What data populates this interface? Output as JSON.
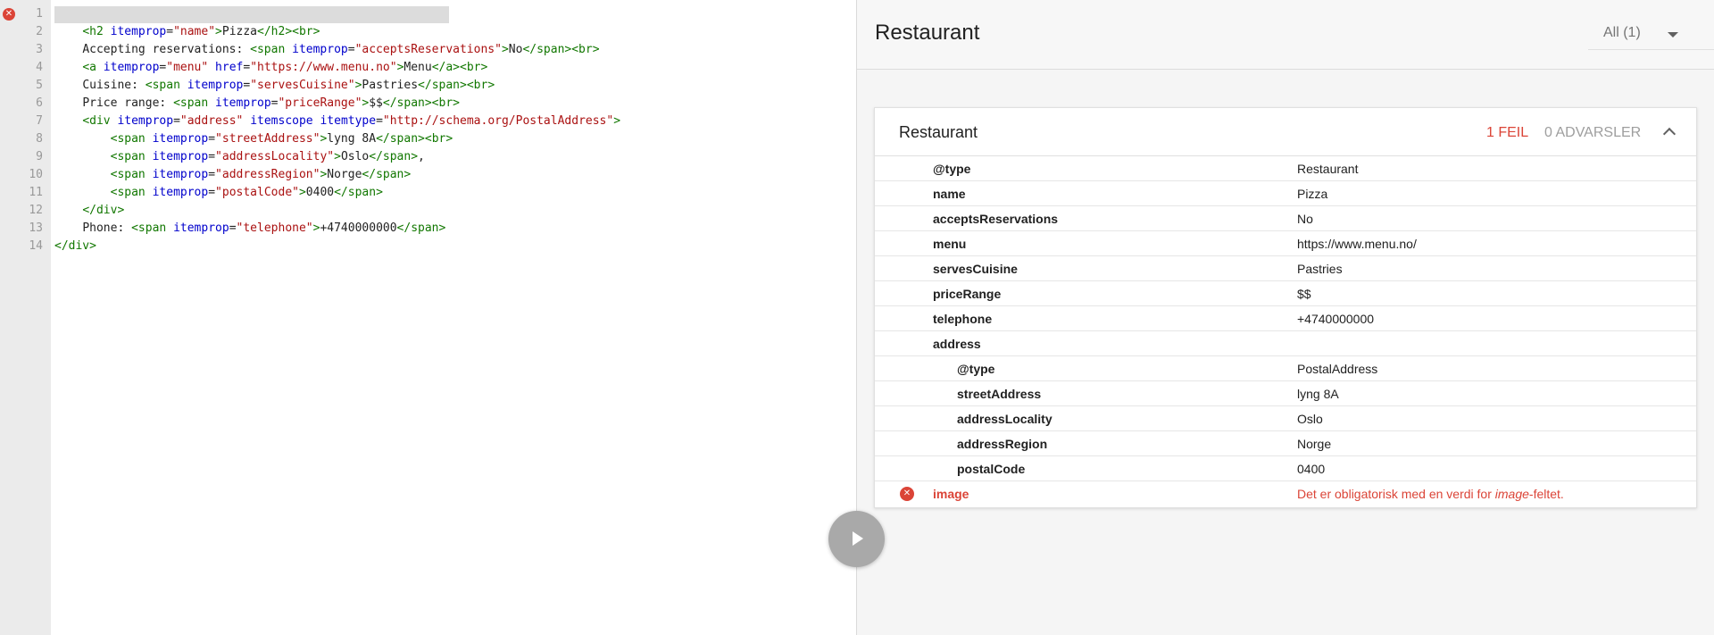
{
  "editor": {
    "line_numbers": [
      "1",
      "2",
      "3",
      "4",
      "5",
      "6",
      "7",
      "8",
      "9",
      "10",
      "11",
      "12",
      "13",
      "14"
    ],
    "error_marker": "✕",
    "lines": [
      [],
      [
        {
          "c": "t",
          "s": "<h2 "
        },
        {
          "c": "a",
          "s": "itemprop"
        },
        {
          "c": "",
          "s": "="
        },
        {
          "c": "v",
          "s": "\"name\""
        },
        {
          "c": "t",
          "s": ">"
        },
        {
          "c": "",
          "s": "Pizza"
        },
        {
          "c": "t",
          "s": "</h2><br>"
        }
      ],
      [
        {
          "c": "",
          "s": "Accepting reservations: "
        },
        {
          "c": "t",
          "s": "<span "
        },
        {
          "c": "a",
          "s": "itemprop"
        },
        {
          "c": "",
          "s": "="
        },
        {
          "c": "v",
          "s": "\"acceptsReservations\""
        },
        {
          "c": "t",
          "s": ">"
        },
        {
          "c": "",
          "s": "No"
        },
        {
          "c": "t",
          "s": "</span><br>"
        }
      ],
      [
        {
          "c": "t",
          "s": "<a "
        },
        {
          "c": "a",
          "s": "itemprop"
        },
        {
          "c": "",
          "s": "="
        },
        {
          "c": "v",
          "s": "\"menu\""
        },
        {
          "c": "",
          "s": " "
        },
        {
          "c": "a",
          "s": "href"
        },
        {
          "c": "",
          "s": "="
        },
        {
          "c": "v",
          "s": "\"https://www.menu.no\""
        },
        {
          "c": "t",
          "s": ">"
        },
        {
          "c": "",
          "s": "Menu"
        },
        {
          "c": "t",
          "s": "</a><br>"
        }
      ],
      [
        {
          "c": "",
          "s": "Cuisine: "
        },
        {
          "c": "t",
          "s": "<span "
        },
        {
          "c": "a",
          "s": "itemprop"
        },
        {
          "c": "",
          "s": "="
        },
        {
          "c": "v",
          "s": "\"servesCuisine\""
        },
        {
          "c": "t",
          "s": ">"
        },
        {
          "c": "",
          "s": "Pastries"
        },
        {
          "c": "t",
          "s": "</span><br>"
        }
      ],
      [
        {
          "c": "",
          "s": "Price range: "
        },
        {
          "c": "t",
          "s": "<span "
        },
        {
          "c": "a",
          "s": "itemprop"
        },
        {
          "c": "",
          "s": "="
        },
        {
          "c": "v",
          "s": "\"priceRange\""
        },
        {
          "c": "t",
          "s": ">"
        },
        {
          "c": "",
          "s": "$$"
        },
        {
          "c": "t",
          "s": "</span><br>"
        }
      ],
      [
        {
          "c": "t",
          "s": "<div "
        },
        {
          "c": "a",
          "s": "itemprop"
        },
        {
          "c": "",
          "s": "="
        },
        {
          "c": "v",
          "s": "\"address\""
        },
        {
          "c": "",
          "s": " "
        },
        {
          "c": "a",
          "s": "itemscope"
        },
        {
          "c": "",
          "s": " "
        },
        {
          "c": "a",
          "s": "itemtype"
        },
        {
          "c": "",
          "s": "="
        },
        {
          "c": "v",
          "s": "\"http://schema.org/PostalAddress\""
        },
        {
          "c": "t",
          "s": ">"
        }
      ],
      [
        {
          "c": "t",
          "s": "<span "
        },
        {
          "c": "a",
          "s": "itemprop"
        },
        {
          "c": "",
          "s": "="
        },
        {
          "c": "v",
          "s": "\"streetAddress\""
        },
        {
          "c": "t",
          "s": ">"
        },
        {
          "c": "",
          "s": "lyng 8A"
        },
        {
          "c": "t",
          "s": "</span><br>"
        }
      ],
      [
        {
          "c": "t",
          "s": "<span "
        },
        {
          "c": "a",
          "s": "itemprop"
        },
        {
          "c": "",
          "s": "="
        },
        {
          "c": "v",
          "s": "\"addressLocality\""
        },
        {
          "c": "t",
          "s": ">"
        },
        {
          "c": "",
          "s": "Oslo"
        },
        {
          "c": "t",
          "s": "</span>"
        },
        {
          "c": "",
          "s": ","
        }
      ],
      [
        {
          "c": "t",
          "s": "<span "
        },
        {
          "c": "a",
          "s": "itemprop"
        },
        {
          "c": "",
          "s": "="
        },
        {
          "c": "v",
          "s": "\"addressRegion\""
        },
        {
          "c": "t",
          "s": ">"
        },
        {
          "c": "",
          "s": "Norge"
        },
        {
          "c": "t",
          "s": "</span>"
        }
      ],
      [
        {
          "c": "t",
          "s": "<span "
        },
        {
          "c": "a",
          "s": "itemprop"
        },
        {
          "c": "",
          "s": "="
        },
        {
          "c": "v",
          "s": "\"postalCode\""
        },
        {
          "c": "t",
          "s": ">"
        },
        {
          "c": "",
          "s": "0400"
        },
        {
          "c": "t",
          "s": "</span>"
        }
      ],
      [
        {
          "c": "t",
          "s": "</div>"
        }
      ],
      [
        {
          "c": "",
          "s": "Phone: "
        },
        {
          "c": "t",
          "s": "<span "
        },
        {
          "c": "a",
          "s": "itemprop"
        },
        {
          "c": "",
          "s": "="
        },
        {
          "c": "v",
          "s": "\"telephone\""
        },
        {
          "c": "t",
          "s": ">"
        },
        {
          "c": "",
          "s": "+4740000000"
        },
        {
          "c": "t",
          "s": "</span>"
        }
      ],
      [
        {
          "c": "t",
          "s": "</div>"
        }
      ]
    ]
  },
  "results": {
    "title": "Restaurant",
    "filter_label": "All (1)",
    "card": {
      "title": "Restaurant",
      "error_count": "1 FEIL",
      "warning_count": "0 ADVARSLER",
      "rows": [
        {
          "key": "@type",
          "value": "Restaurant",
          "sub": false,
          "error": false
        },
        {
          "key": "name",
          "value": "Pizza",
          "sub": false,
          "error": false
        },
        {
          "key": "acceptsReservations",
          "value": "No",
          "sub": false,
          "error": false
        },
        {
          "key": "menu",
          "value": "https://www.menu.no/",
          "sub": false,
          "error": false
        },
        {
          "key": "servesCuisine",
          "value": "Pastries",
          "sub": false,
          "error": false
        },
        {
          "key": "priceRange",
          "value": "$$",
          "sub": false,
          "error": false
        },
        {
          "key": "telephone",
          "value": "+4740000000",
          "sub": false,
          "error": false
        },
        {
          "key": "address",
          "value": "",
          "sub": false,
          "error": false
        },
        {
          "key": "@type",
          "value": "PostalAddress",
          "sub": true,
          "error": false
        },
        {
          "key": "streetAddress",
          "value": "lyng 8A",
          "sub": true,
          "error": false
        },
        {
          "key": "addressLocality",
          "value": "Oslo",
          "sub": true,
          "error": false
        },
        {
          "key": "addressRegion",
          "value": "Norge",
          "sub": true,
          "error": false
        },
        {
          "key": "postalCode",
          "value": "0400",
          "sub": true,
          "error": false
        },
        {
          "key": "image",
          "value_parts": [
            "Det er obligatorisk med en verdi for ",
            "image",
            "-feltet."
          ],
          "sub": false,
          "error": true,
          "icon": "✕"
        }
      ]
    }
  }
}
